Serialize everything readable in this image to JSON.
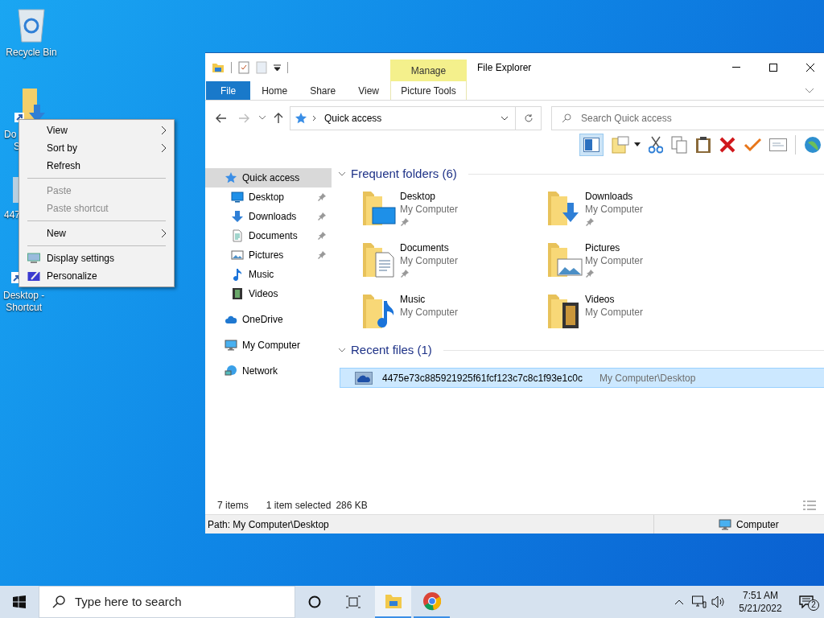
{
  "desktop_icons": [
    {
      "kind": "recycle",
      "lines": [
        "Recycle Bin"
      ]
    },
    {
      "kind": "downloads",
      "lines": [
        "Do",
        "S"
      ]
    },
    {
      "kind": "file",
      "lines": [
        "447"
      ]
    },
    {
      "kind": "desktop",
      "lines": [
        "Desktop -",
        "Shortcut"
      ]
    }
  ],
  "context_menu": [
    {
      "kind": "item",
      "label": "View",
      "submenu": true,
      "disabled": false
    },
    {
      "kind": "item",
      "label": "Sort by",
      "submenu": true,
      "disabled": false
    },
    {
      "kind": "item",
      "label": "Refresh",
      "submenu": false,
      "disabled": false
    },
    {
      "kind": "separator"
    },
    {
      "kind": "item",
      "label": "Paste",
      "submenu": false,
      "disabled": true
    },
    {
      "kind": "item",
      "label": "Paste shortcut",
      "submenu": false,
      "disabled": true
    },
    {
      "kind": "separator"
    },
    {
      "kind": "item",
      "label": "New",
      "submenu": true,
      "disabled": false
    },
    {
      "kind": "separator"
    },
    {
      "kind": "display",
      "label": "Display settings",
      "submenu": false,
      "disabled": false
    },
    {
      "kind": "personalize",
      "label": "Personalize",
      "submenu": false,
      "disabled": false
    }
  ],
  "window": {
    "title": "File Explorer",
    "contextual_tab": "Manage",
    "tabs": [
      {
        "label": "File",
        "kind": "file"
      },
      {
        "label": "Home",
        "kind": "tab"
      },
      {
        "label": "Share",
        "kind": "tab"
      },
      {
        "label": "View",
        "kind": "tab"
      },
      {
        "label": "Picture Tools",
        "kind": "contextual"
      }
    ],
    "address": "Quick access",
    "search": {
      "placeholder": "Search Quick access"
    },
    "sidebar": [
      {
        "label": "Quick access",
        "kind": "star",
        "selected": true,
        "children": [
          {
            "label": "Desktop",
            "kind": "desktop",
            "selected": false,
            "pinned": true
          },
          {
            "label": "Downloads",
            "kind": "downloads",
            "selected": false,
            "pinned": true
          },
          {
            "label": "Documents",
            "kind": "documents",
            "selected": false,
            "pinned": true
          },
          {
            "label": "Pictures",
            "kind": "pictures",
            "selected": false,
            "pinned": true
          },
          {
            "label": "Music",
            "kind": "music",
            "selected": false,
            "pinned": false
          },
          {
            "label": "Videos",
            "kind": "videos",
            "selected": false,
            "pinned": false
          }
        ]
      },
      {
        "label": "OneDrive",
        "kind": "cloud",
        "selected": false
      },
      {
        "label": "My Computer",
        "kind": "computer",
        "selected": false
      },
      {
        "label": "Network",
        "kind": "network",
        "selected": false
      }
    ],
    "frequent": {
      "title": "Frequent folders (6)",
      "expanded": true,
      "items": [
        {
          "name": "Desktop",
          "location": "My Computer",
          "kind": "desktop",
          "pinned": true
        },
        {
          "name": "Downloads",
          "location": "My Computer",
          "kind": "downloads",
          "pinned": true
        },
        {
          "name": "Documents",
          "location": "My Computer",
          "kind": "documents",
          "pinned": true
        },
        {
          "name": "Pictures",
          "location": "My Computer",
          "kind": "pictures",
          "pinned": true
        },
        {
          "name": "Music",
          "location": "My Computer",
          "kind": "music",
          "pinned": false
        },
        {
          "name": "Videos",
          "location": "My Computer",
          "kind": "videos",
          "pinned": false
        }
      ]
    },
    "recent": {
      "title": "Recent files (1)",
      "expanded": true,
      "items": [
        {
          "name": "4475e73c885921925f61fcf123c7c8c1f93e1c0c",
          "path": "My Computer\\Desktop",
          "selected": true
        }
      ]
    },
    "status": {
      "count": "7 items",
      "selection": "1 item selected",
      "size": "286 KB"
    },
    "path_bar": {
      "path": "Path: My Computer\\Desktop",
      "location": "Computer"
    }
  },
  "taskbar": {
    "search_placeholder": "Type here to search",
    "apps": [
      {
        "kind": "explorer",
        "selected": true
      },
      {
        "kind": "chrome",
        "selected": false
      }
    ],
    "time": "7:51 AM",
    "date": "5/21/2022",
    "notifications": "2"
  }
}
